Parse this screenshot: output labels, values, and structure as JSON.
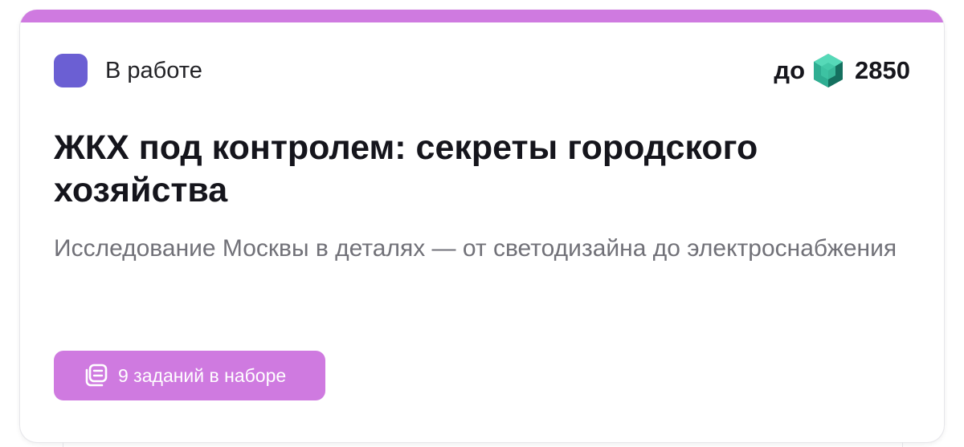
{
  "colors": {
    "accent": "#cf7ae0",
    "status_dot": "#6b5fd3",
    "gem_light": "#3fc6a4",
    "gem_dark": "#1f8c78"
  },
  "card": {
    "status": {
      "icon": "status-square",
      "label": "В работе"
    },
    "reward": {
      "prefix": "до",
      "icon": "gem-icon",
      "value": "2850"
    },
    "title": "ЖКХ под контролем: секреты городского хозяйства",
    "subtitle": "Исследование Москвы в деталях — от светодизайна до электроснабжения",
    "tasks_button": {
      "icon": "task-stack-icon",
      "label": "9 заданий в наборе"
    }
  }
}
